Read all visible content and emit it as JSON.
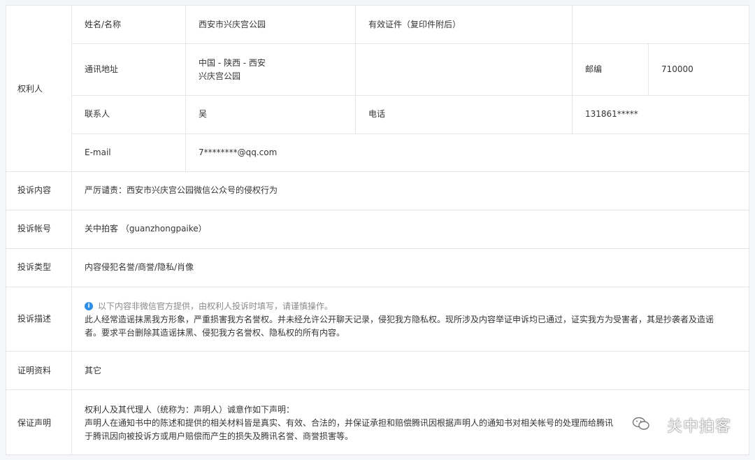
{
  "owner": {
    "section_label": "权利人",
    "name_label": "姓名/名称",
    "name_value": "西安市兴庆宫公园",
    "id_label": "有效证件（复印件附后）",
    "address_label": "通讯地址",
    "address_line1": "中国 - 陕西 - 西安",
    "address_line2": "兴庆宫公园",
    "zip_label": "邮编",
    "zip_value": "710000",
    "contact_label": "联系人",
    "contact_value": "吴",
    "phone_label": "电话",
    "phone_value": "131861*****",
    "email_label": "E-mail",
    "email_value": "7********@qq.com"
  },
  "complaint": {
    "content_label": "投诉内容",
    "content_value": "严厉谴责：西安市兴庆宫公园微信公众号的侵权行为",
    "account_label": "投诉帐号",
    "account_value": "关中拍客 （guanzhongpaike）",
    "type_label": "投诉类型",
    "type_value": "内容侵犯名誉/商誉/隐私/肖像",
    "desc_label": "投诉描述",
    "desc_notice": "以下内容非微信官方提供，由权利人投诉时填写，请谨慎操作。",
    "desc_line1": "此人经常造谣抹黑我方形象，严重损害我方名誉权。并未经允许公开聊天记录，侵犯我方隐私权。现所涉及内容举证申诉均已通过，证实我方为受害者，其是抄袭者及造谣",
    "desc_line2": "者。要求平台删除其造谣抹黑、侵犯我方名誉权、隐私权的所有内容。",
    "proof_label": "证明资料",
    "proof_value": "其它",
    "statement_label": "保证声明",
    "statement_line1": "权利人及其代理人（统称为：声明人）诚意作如下声明：",
    "statement_line2": "声明人在通知书中的陈述和提供的相关材料皆是真实、有效、合法的，并保证承担和赔偿腾讯因根据声明人的通知书对相关帐号的处理而给腾讯",
    "statement_line3": "于腾讯因向被投诉方或用户赔偿而产生的损失及腾讯名誉、商誉损害等。"
  },
  "watermark": {
    "text": "关中拍客",
    "icon": "wechat-icon"
  },
  "colors": {
    "border": "#e4e6ea",
    "text": "#353535",
    "notice": "#8a8a8a",
    "info_icon": "#2f8ee5"
  }
}
